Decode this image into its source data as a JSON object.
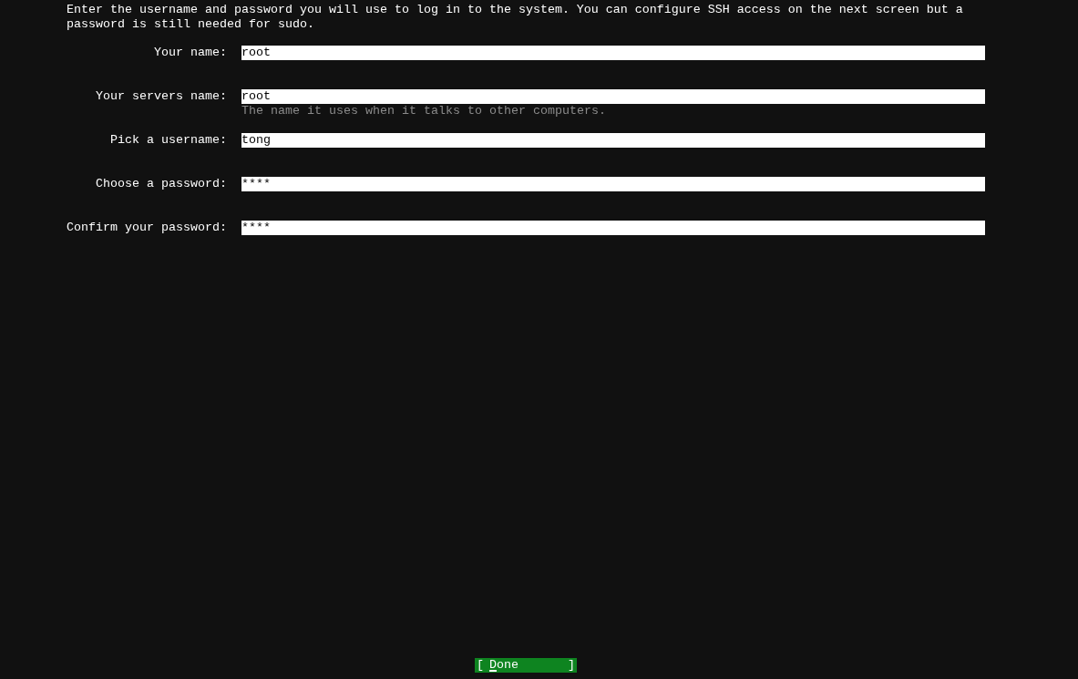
{
  "intro": "Enter the username and password you will use to log in to the system. You can configure SSH access on the next screen but a password is still needed for sudo.",
  "fields": [
    {
      "label": "Your name:",
      "value": "root"
    },
    {
      "label": "Your servers name:",
      "value": "root",
      "hint": "The name it uses when it talks to other computers."
    },
    {
      "label": "Pick a username:",
      "value": "tong"
    },
    {
      "label": "Choose a password:",
      "value": "****"
    },
    {
      "label": "Confirm your password:",
      "value": "****"
    }
  ],
  "done_button": {
    "left_bracket": "[",
    "label": "Done",
    "right_bracket": "]",
    "focused": true
  }
}
